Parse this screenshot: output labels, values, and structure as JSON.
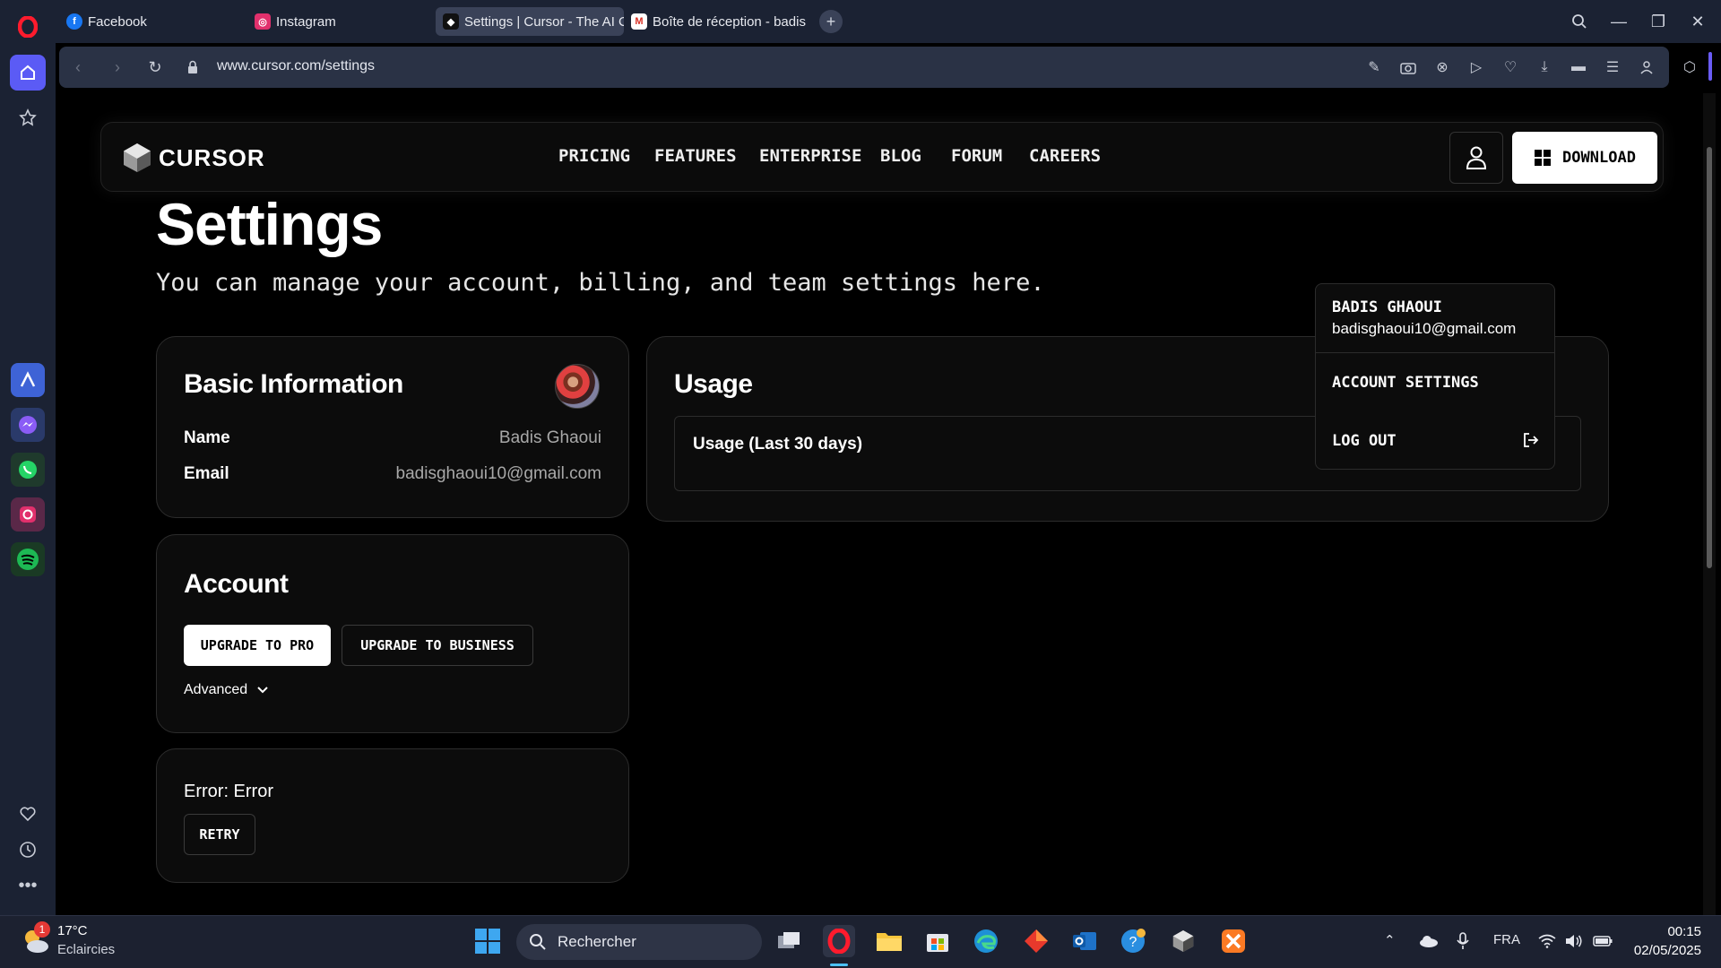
{
  "browser": {
    "tabs": [
      {
        "label": "Facebook",
        "icon": "facebook-icon"
      },
      {
        "label": "Instagram",
        "icon": "instagram-icon"
      },
      {
        "label": "Settings | Cursor - The AI C",
        "icon": "cursor-icon",
        "active": true
      },
      {
        "label": "Boîte de réception - badis",
        "icon": "gmail-icon"
      }
    ],
    "url": "www.cursor.com/settings"
  },
  "site_nav": {
    "logo_text": "CURSOR",
    "links": [
      "PRICING",
      "FEATURES",
      "ENTERPRISE",
      "BLOG",
      "FORUM",
      "CAREERS"
    ],
    "download_label": "DOWNLOAD"
  },
  "page": {
    "title": "Settings",
    "subtitle": "You can manage your account, billing, and team settings here."
  },
  "basic_info": {
    "title": "Basic Information",
    "name_label": "Name",
    "name_value": "Badis Ghaoui",
    "email_label": "Email",
    "email_value": "badisghaoui10@gmail.com"
  },
  "account": {
    "title": "Account",
    "upgrade_pro": "UPGRADE TO PRO",
    "upgrade_business": "UPGRADE TO BUSINESS",
    "advanced": "Advanced"
  },
  "error_card": {
    "message": "Error: Error",
    "retry": "RETRY"
  },
  "usage": {
    "title": "Usage",
    "period": "Usage (Last 30 days)"
  },
  "dropdown": {
    "name": "BADIS GHAOUI",
    "email": "badisghaoui10@gmail.com",
    "account_settings": "ACCOUNT SETTINGS",
    "log_out": "LOG OUT"
  },
  "taskbar": {
    "weather_temp": "17°C",
    "weather_desc": "Eclaircies",
    "weather_badge": "1",
    "search_placeholder": "Rechercher",
    "lang": "FRA",
    "time": "00:15",
    "date": "02/05/2025"
  }
}
